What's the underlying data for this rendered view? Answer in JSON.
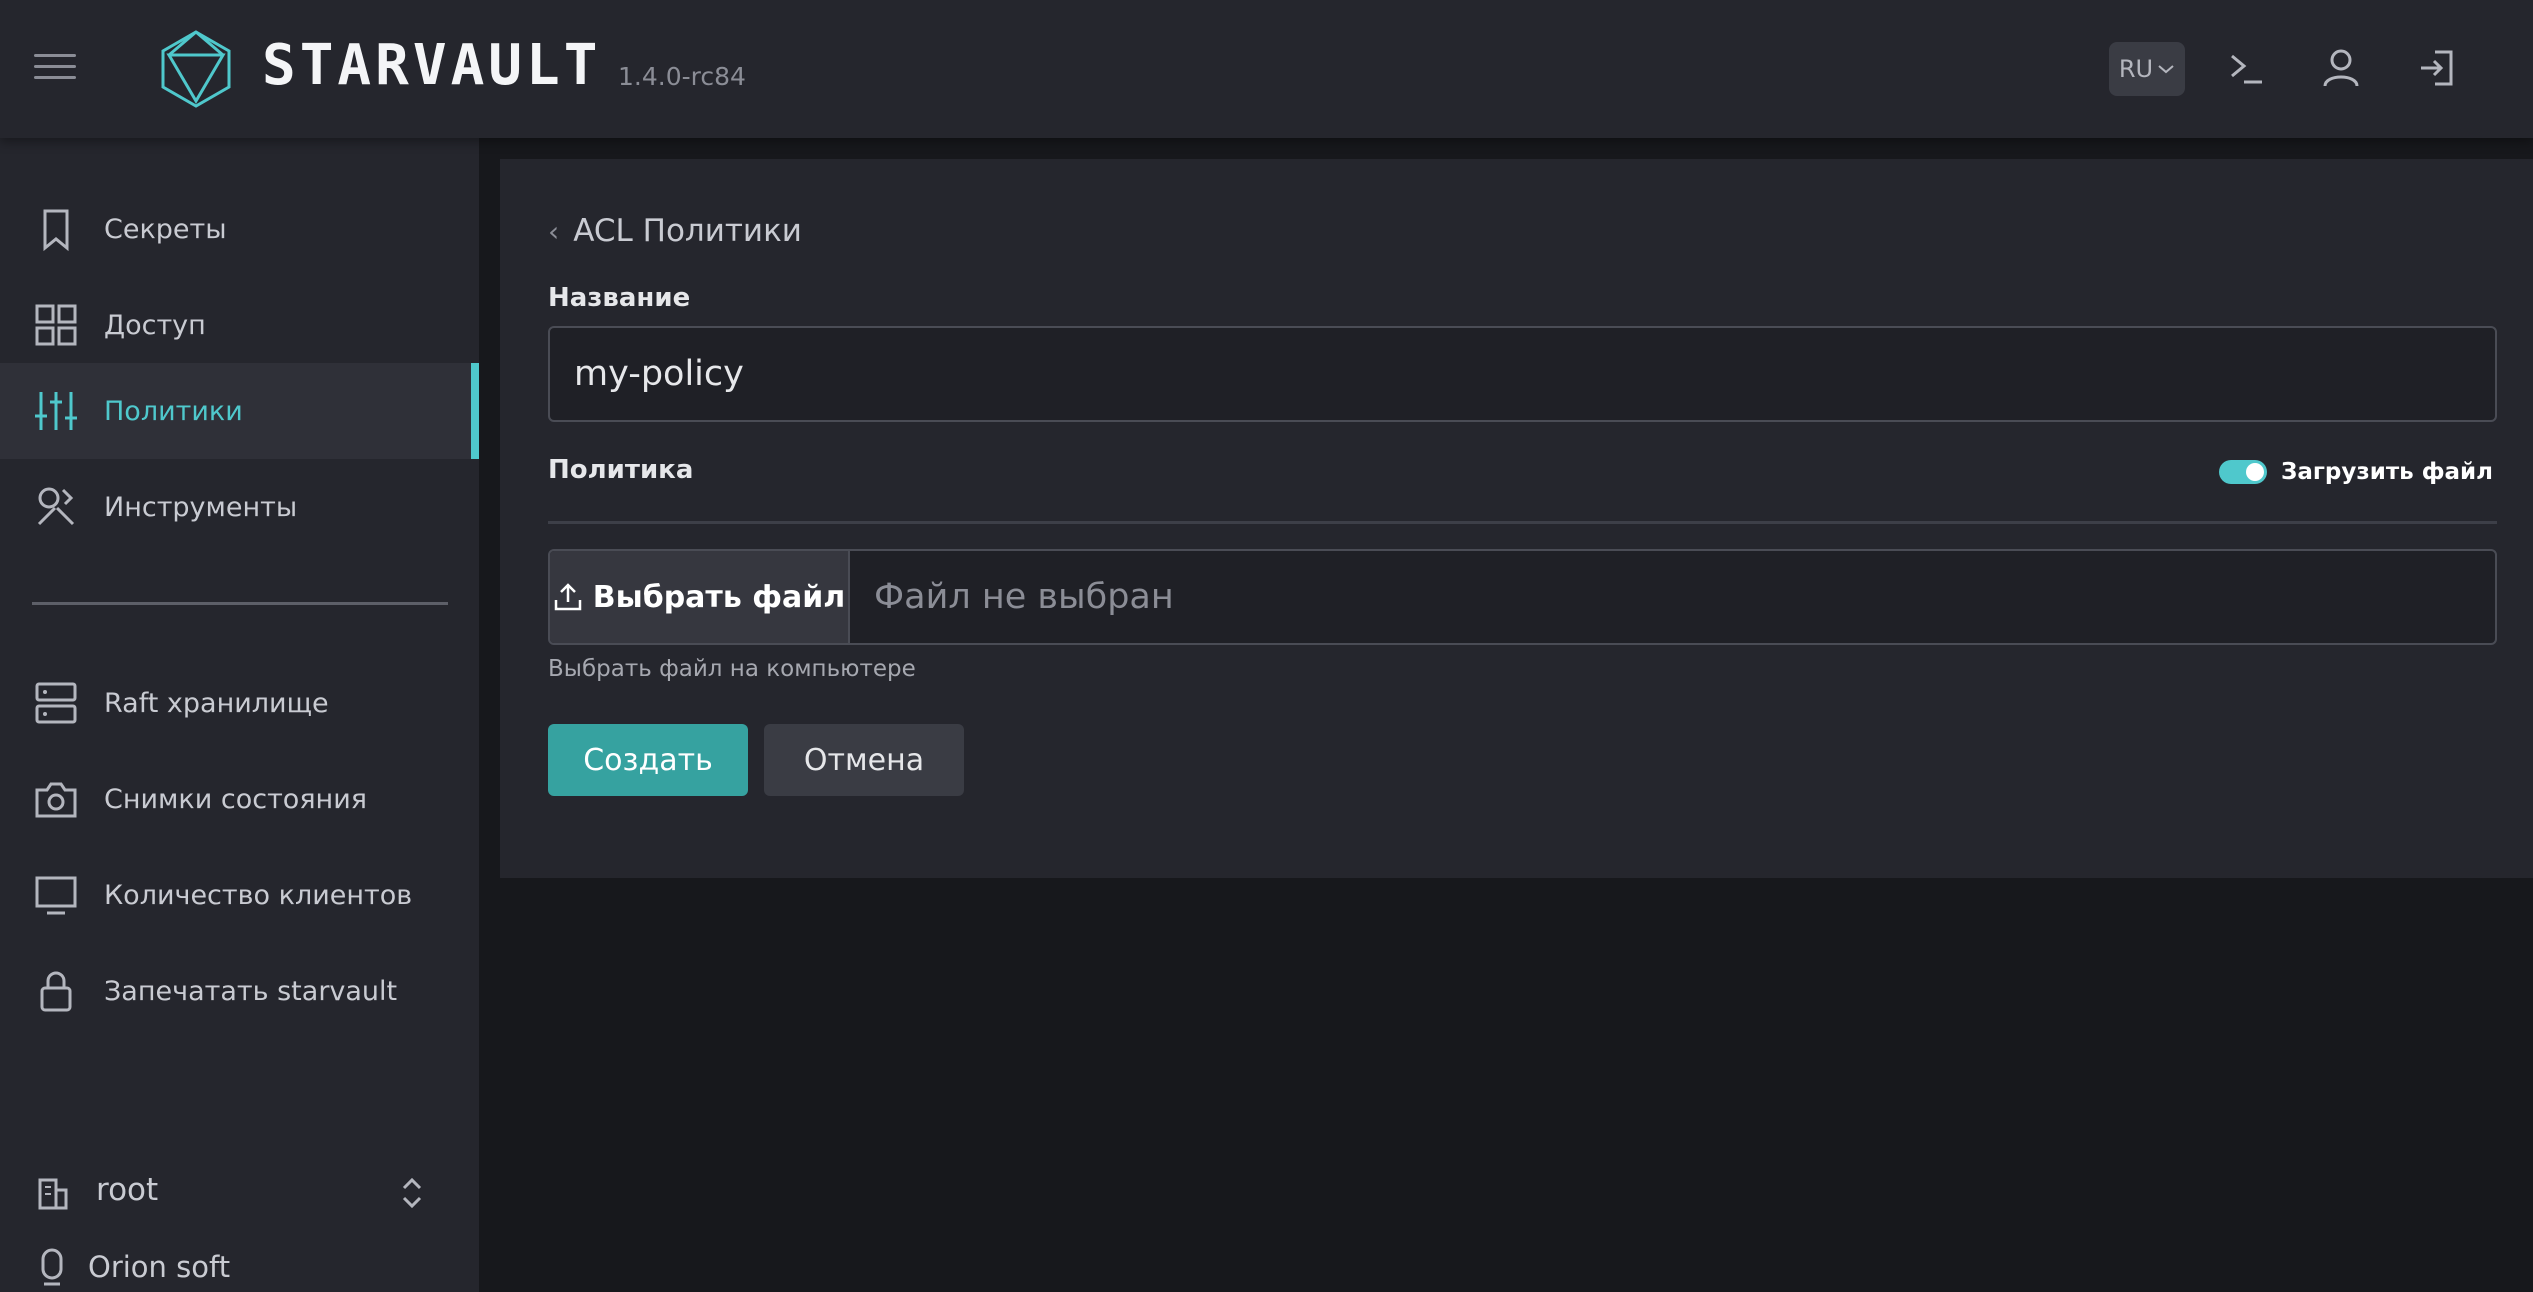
{
  "header": {
    "logo_text": "STARVAULT",
    "version": "1.4.0-rc84",
    "language": "RU",
    "icons": [
      "terminal-icon",
      "user-icon",
      "logout-icon"
    ]
  },
  "sidebar": {
    "items": [
      {
        "label": "Секреты",
        "icon": "bookmark-icon"
      },
      {
        "label": "Доступ",
        "icon": "grid-icon"
      },
      {
        "label": "Политики",
        "icon": "sliders-icon",
        "active": true
      },
      {
        "label": "Инструменты",
        "icon": "tools-icon"
      },
      {
        "label": "Raft хранилище",
        "icon": "server-icon"
      },
      {
        "label": "Снимки состояния",
        "icon": "camera-icon"
      },
      {
        "label": "Количество клиентов",
        "icon": "monitor-icon"
      },
      {
        "label": "Запечатать starvault",
        "icon": "lock-icon"
      }
    ],
    "namespace": "root",
    "organization": "Orion soft"
  },
  "form": {
    "back_label": "ACL Политики",
    "name_label": "Название",
    "name_value": "my-policy",
    "policy_label": "Политика",
    "upload_toggle_label": "Загрузить файл",
    "upload_toggle_on": true,
    "choose_file_label": "Выбрать файл",
    "file_status": "Файл не выбран",
    "file_helper": "Выбрать файл на компьютере",
    "create_label": "Создать",
    "cancel_label": "Отмена"
  },
  "colors": {
    "accent": "#4fc8cc",
    "primary_button": "#36a2a0",
    "surface": "#25262d",
    "background": "#17181c"
  }
}
